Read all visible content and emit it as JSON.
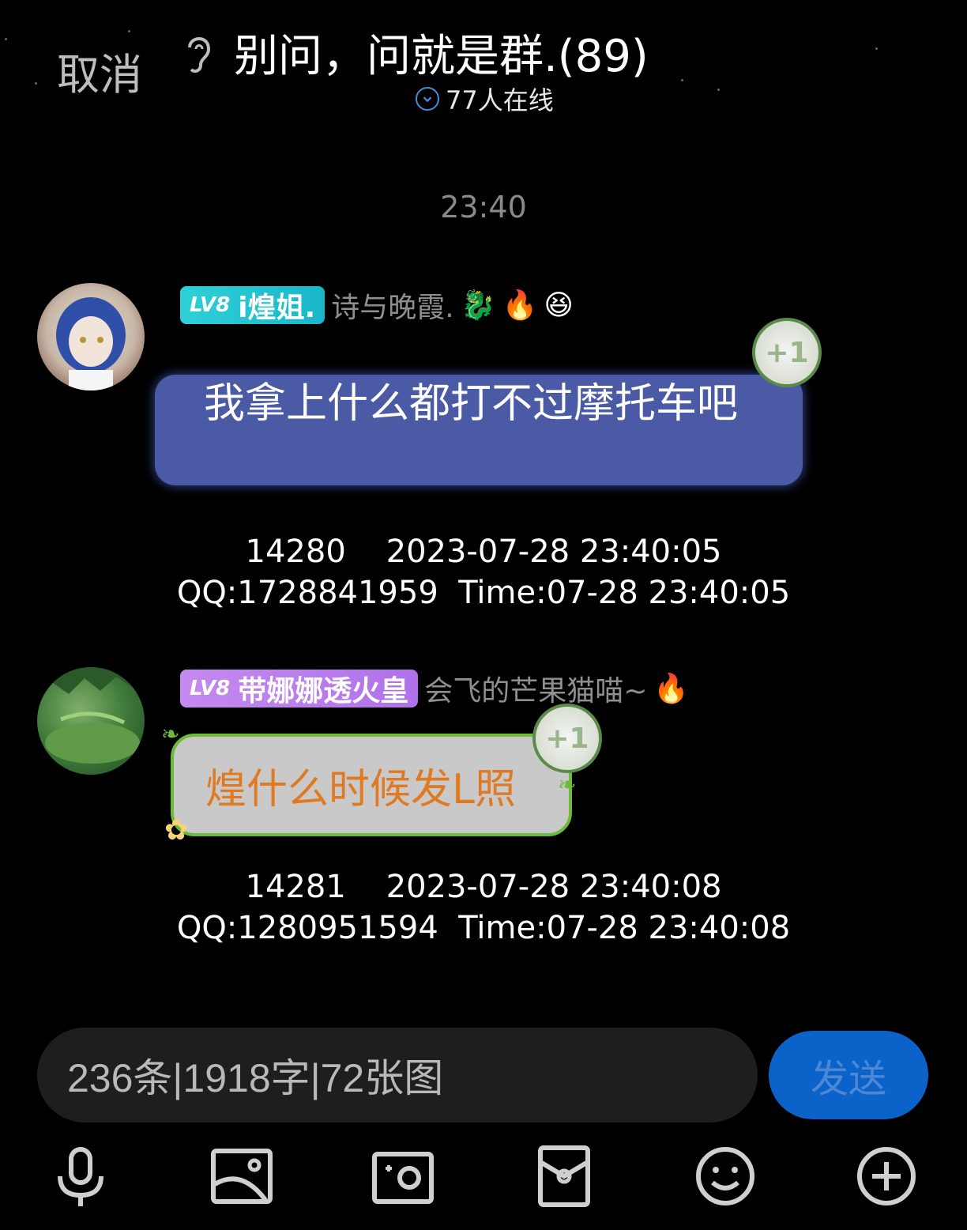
{
  "header": {
    "cancel_label": "取消",
    "title": "别问，问就是群.(89)",
    "online": "77人在线"
  },
  "divider_time": "23:40",
  "messages": [
    {
      "badge_level": "LV8",
      "badge_title": "i煌姐.",
      "nickname": "诗与晚霞.",
      "emojis": [
        "🐉",
        "🔥",
        "😆"
      ],
      "text": "我拿上什么都打不过摩托车吧",
      "reaction": "+1",
      "meta_line1": "14280    2023-07-28 23:40:05",
      "meta_line2": "QQ:1728841959  Time:07-28 23:40:05"
    },
    {
      "badge_level": "LV8",
      "badge_title": "带娜娜透火皇",
      "nickname": "会飞的芒果猫喵~",
      "emojis": [
        "🔥"
      ],
      "text": "煌什么时候发L照",
      "reaction": "+1",
      "meta_line1": "14281    2023-07-28 23:40:08",
      "meta_line2": "QQ:1280951594  Time:07-28 23:40:08"
    }
  ],
  "input": {
    "value": "236条|1918字|72张图",
    "send_label": "发送"
  },
  "toolbar": [
    "microphone-icon",
    "image-icon",
    "camera-icon",
    "red-packet-icon",
    "emoji-icon",
    "plus-icon"
  ],
  "colors": {
    "background": "#000000",
    "badge1": "#1ab6c8",
    "badge2": "#b071ea",
    "bubble1": "#4a5aa5",
    "bubble2": "#c9c9c9",
    "bubble2_text": "#e07a22",
    "send_button": "#0b63c9"
  }
}
